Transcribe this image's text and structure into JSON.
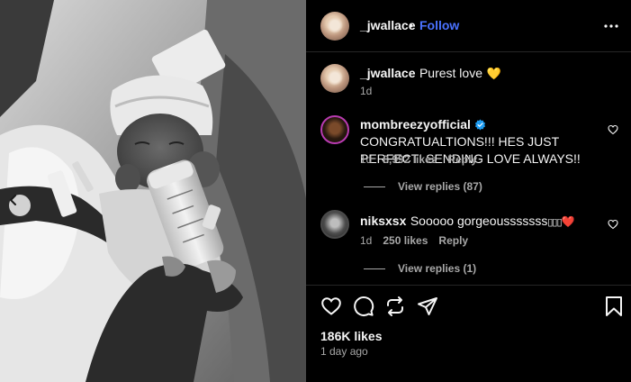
{
  "post": {
    "owner_username": "_jwallace",
    "separator": "•",
    "follow_label": "Follow"
  },
  "caption": {
    "username": "_jwallace",
    "text": "Purest love",
    "emoji": "💛",
    "time": "1d"
  },
  "comments": [
    {
      "username": "mombreezyofficial",
      "verified": true,
      "text": "CONGRATUALTIONS!!! HES JUST PERFECT! SENDING LOVE ALWAYS!!",
      "time": "1d",
      "likes": "8,992 likes",
      "reply_label": "Reply",
      "view_replies": "View replies (87)"
    },
    {
      "username": "niksxsx",
      "verified": false,
      "text": "Sooooo gorgeousssssss",
      "emoji_boxes": "▯▯▯",
      "emoji": "❤️",
      "time": "1d",
      "likes": "250 likes",
      "reply_label": "Reply",
      "view_replies": "View replies (1)"
    }
  ],
  "footer": {
    "likes": "186K likes",
    "time_ago": "1 day ago"
  },
  "icons": {
    "accent": "#4a72ff",
    "story_ring": "#b83bb0",
    "verified": "#1d9bf0",
    "heart_emoji": "#e0213a",
    "yellow_heart": "#f4c700"
  }
}
